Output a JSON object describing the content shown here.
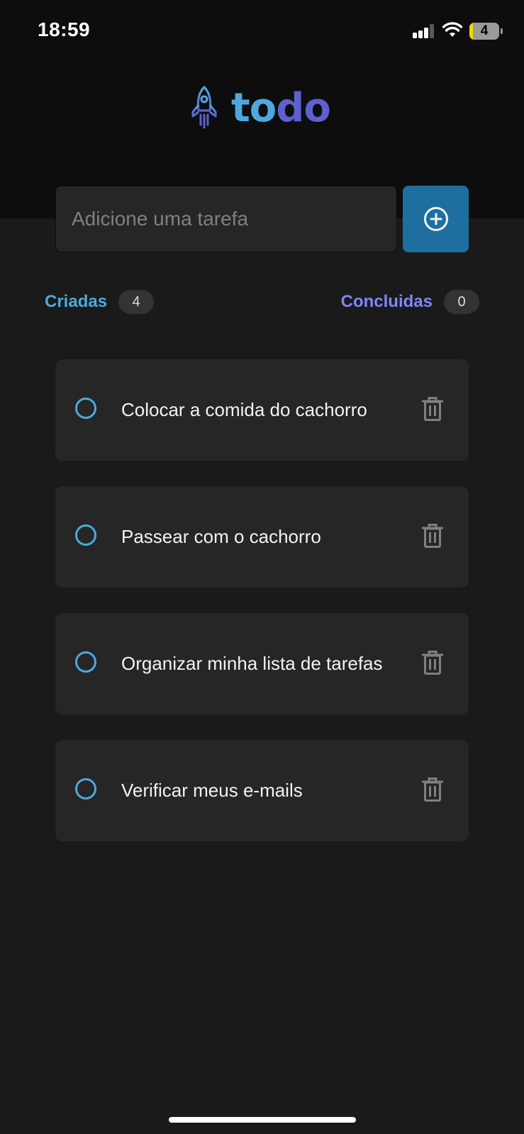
{
  "status_bar": {
    "time": "18:59",
    "battery_level": "4"
  },
  "logo": {
    "part1": "to",
    "part2": "do"
  },
  "new_task": {
    "placeholder": "Adicione uma tarefa",
    "value": "",
    "add_icon": "plus-circle-icon"
  },
  "counters": {
    "created_label": "Criadas",
    "created_count": "4",
    "done_label": "Concluidas",
    "done_count": "0"
  },
  "tasks": [
    {
      "text": "Colocar a comida do cachorro",
      "done": false
    },
    {
      "text": "Passear com o cachorro",
      "done": false
    },
    {
      "text": "Organizar minha lista de tarefas",
      "done": false
    },
    {
      "text": "Verificar meus e-mails",
      "done": false
    }
  ],
  "colors": {
    "header_bg": "#0d0d0d",
    "body_bg": "#1a1a1a",
    "card_bg": "#262626",
    "blue": "#4ea8de",
    "blue_dark": "#1e6f9f",
    "purple": "#8284fa",
    "purple_dark": "#5e60ce"
  }
}
